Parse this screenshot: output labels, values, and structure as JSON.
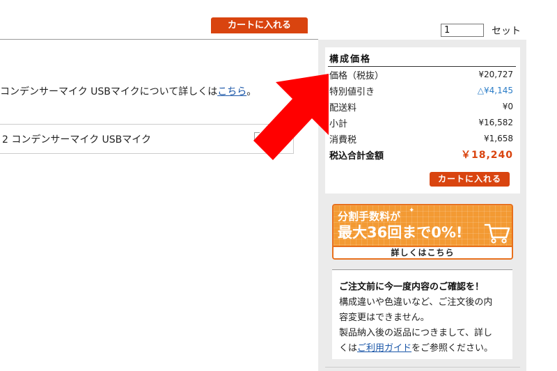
{
  "header": {
    "add_to_cart_label": "カートに入れる",
    "quantity_value": "1",
    "quantity_unit": "セット"
  },
  "main": {
    "description_text": "コンデンサーマイク USBマイクについて詳しくは",
    "description_link": "こちら",
    "description_suffix": "。",
    "product_name": "2 コンデンサーマイク USBマイク"
  },
  "price_panel": {
    "title": "構成価格",
    "rows": [
      {
        "label": "価格（税抜）",
        "value": "¥20,727"
      },
      {
        "label": "特別値引き",
        "value": "△¥4,145"
      },
      {
        "label": "配送料",
        "value": "¥0"
      },
      {
        "label": "小計",
        "value": "¥16,582"
      },
      {
        "label": "消費税",
        "value": "¥1,658"
      }
    ],
    "total_label": "税込合計金額",
    "total_value": "￥18,240",
    "add_to_cart_label": "カートに入れる"
  },
  "banner": {
    "line1": "分割手数料が",
    "line2": "最大36回まで0%!",
    "details_label": "詳しくはこちら"
  },
  "notice": {
    "title": "ご注文前に今一度内容のご確認を！",
    "line1": "構成違いや色違いなど、ご注文後の内",
    "line2": "容変更はできません。",
    "line3": "製品納入後の返品につきまして、詳し",
    "line4_prefix": "くは",
    "line4_link": "ご利用ガイド",
    "line4_suffix": "をご参照ください。"
  },
  "colors": {
    "accent_orange": "#d9440f",
    "banner_orange": "#f39a33",
    "discount_blue": "#2a7cc7",
    "link_blue": "#1a56a8",
    "arrow_red": "#ff0000"
  }
}
